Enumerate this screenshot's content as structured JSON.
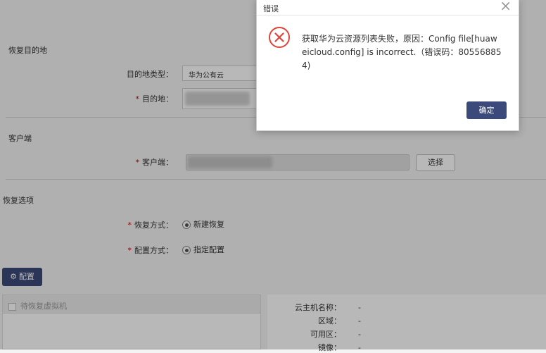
{
  "sections": {
    "restore_destination": "恢复目的地",
    "client": "客户端",
    "restore_options": "恢复选项"
  },
  "form": {
    "dest_type_label": "目的地类型：",
    "dest_type_value": "华为公有云",
    "dest_label": "目的地：",
    "client_label": "客户端：",
    "select_button": "选择",
    "restore_method_label": "恢复方式：",
    "restore_method_value": "新建恢复",
    "config_method_label": "配置方式：",
    "config_method_value": "指定配置",
    "config_button": "配置"
  },
  "vm_panel": {
    "checkbox_label": "待恢复虚拟机"
  },
  "details": [
    {
      "label": "云主机名称：",
      "value": "-"
    },
    {
      "label": "区域：",
      "value": "-"
    },
    {
      "label": "可用区：",
      "value": "-"
    },
    {
      "label": "镜像：",
      "value": "-"
    }
  ],
  "dialog": {
    "title": "错误",
    "message": "获取华为云资源列表失败，原因：Config file[huaweicloud.config] is incorrect.（错误码：805568854)",
    "ok_button": "确定",
    "close": "×"
  },
  "colors": {
    "primary": "#3b4a7a",
    "error": "#e0433a"
  },
  "icons": {
    "error": "error-circle-icon",
    "gear": "gear-icon",
    "close": "close-icon"
  }
}
